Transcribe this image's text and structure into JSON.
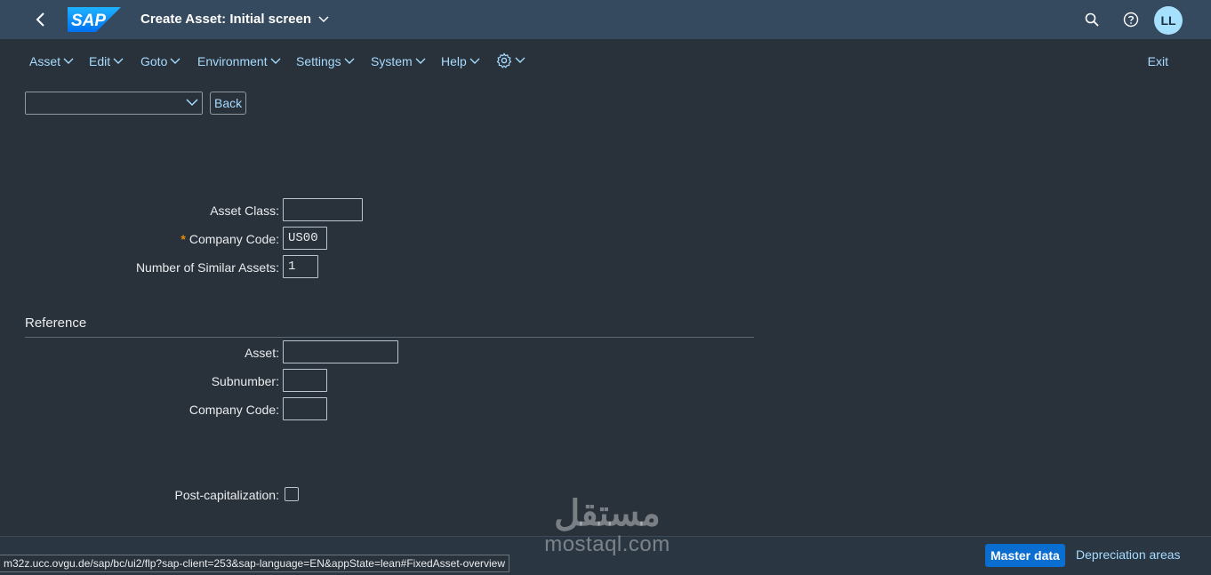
{
  "shell": {
    "logo_text": "SAP",
    "title": "Create Asset: Initial screen",
    "avatar_initials": "LL",
    "icons": [
      "back-icon",
      "search-icon",
      "help-icon"
    ]
  },
  "menu": {
    "items": [
      {
        "label": "Asset"
      },
      {
        "label": "Edit"
      },
      {
        "label": "Goto"
      },
      {
        "label": "Environment"
      },
      {
        "label": "Settings"
      },
      {
        "label": "System"
      },
      {
        "label": "Help"
      }
    ],
    "settings_icon": "gear-icon",
    "exit_label": "Exit"
  },
  "toolbar": {
    "okcode_value": "",
    "back_label": "Back"
  },
  "form": {
    "asset_class_label": "Asset Class:",
    "asset_class_value": "",
    "company_code_label": "Company Code:",
    "company_code_value": "US00",
    "company_code_required": "*",
    "similar_assets_label": "Number of Similar Assets:",
    "similar_assets_value": "1"
  },
  "reference": {
    "title": "Reference",
    "asset_label": "Asset:",
    "asset_value": "",
    "subnumber_label": "Subnumber:",
    "subnumber_value": "",
    "company_code_label": "Company Code:",
    "company_code_value": ""
  },
  "post_cap": {
    "label": "Post-capitalization:",
    "checked": false
  },
  "footer": {
    "master_data_label": "Master data",
    "depreciation_label": "Depreciation areas"
  },
  "status_url": "m32z.ucc.ovgu.de/sap/bc/ui2/flp?sap-client=253&sap-language=EN&appState=lean#FixedAsset-overview",
  "watermark": {
    "arabic": "مستقل",
    "latin": "mostaql.com"
  },
  "colors": {
    "shell_bg": "#354a5f",
    "page_bg": "#29313a",
    "link": "#a6dbff",
    "primary": "#0a6ed1",
    "required": "#e78c07",
    "avatar": "#a6e0ff"
  }
}
